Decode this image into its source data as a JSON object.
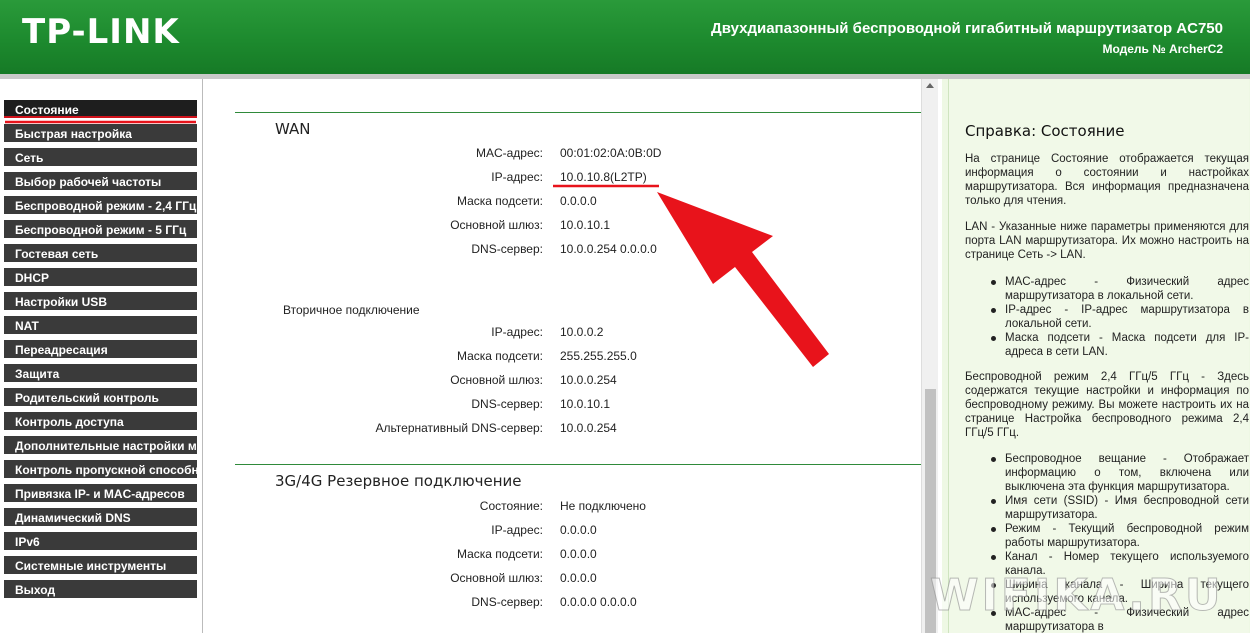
{
  "header": {
    "logo": "TP-LINK",
    "product_title": "Двухдиапазонный беспроводной гигабитный маршрутизатор AC750",
    "model": "Модель № ArcherC2"
  },
  "sidebar": {
    "items": [
      "Состояние",
      "Быстрая настройка",
      "Сеть",
      "Выбор рабочей частоты",
      "Беспроводной режим - 2,4 ГГц",
      "Беспроводной режим - 5 ГГц",
      "Гостевая сеть",
      "DHCP",
      "Настройки USB",
      "NAT",
      "Переадресация",
      "Защита",
      "Родительский контроль",
      "Контроль доступа",
      "Дополнительные настройки м",
      "Контроль пропускной способн",
      "Привязка IP- и MAC-адресов",
      "Динамический DNS",
      "IPv6",
      "Системные инструменты",
      "Выход"
    ],
    "active_index": 0
  },
  "wan": {
    "title": "WAN",
    "rows": [
      {
        "label": "MAC-адрес:",
        "value": "00:01:02:0A:0B:0D"
      },
      {
        "label": "IP-адрес:",
        "value": "10.0.10.8(L2TP)"
      },
      {
        "label": "Маска подсети:",
        "value": "0.0.0.0"
      },
      {
        "label": "Основной шлюз:",
        "value": "10.0.10.1"
      },
      {
        "label": "DNS-сервер:",
        "value": "10.0.0.254 0.0.0.0"
      }
    ],
    "secondary_title": "Вторичное подключение",
    "secondary_rows": [
      {
        "label": "IP-адрес:",
        "value": "10.0.0.2"
      },
      {
        "label": "Маска подсети:",
        "value": "255.255.255.0"
      },
      {
        "label": "Основной шлюз:",
        "value": "10.0.0.254"
      },
      {
        "label": "DNS-сервер:",
        "value": "10.0.10.1"
      },
      {
        "label": "Альтернативный DNS-сервер:",
        "value": "10.0.0.254"
      }
    ]
  },
  "backup": {
    "title": "3G/4G Резервное подключение",
    "rows": [
      {
        "label": "Состояние:",
        "value": "Не подключено"
      },
      {
        "label": "IP-адрес:",
        "value": "0.0.0.0"
      },
      {
        "label": "Маска подсети:",
        "value": "0.0.0.0"
      },
      {
        "label": "Основной шлюз:",
        "value": "0.0.0.0"
      },
      {
        "label": "DNS-сервер:",
        "value": "0.0.0.0 0.0.0.0"
      }
    ]
  },
  "help": {
    "title": "Справка: Состояние",
    "intro": "На странице Состояние отображается текущая информация о состоянии и настройках маршрутизатора. Вся информация предназначена только для чтения.",
    "lan_p": "LAN - Указанные ниже параметры применяются для порта LAN маршрутизатора. Их можно настроить на странице Сеть -> LAN.",
    "lan_items": [
      "MAC-адрес - Физический адрес маршрутизатора в локальной сети.",
      "IP-адрес - IP-адрес маршрутизатора в локальной сети.",
      "Маска подсети - Маска подсети для IP-адреса в сети LAN."
    ],
    "wireless_p": "Беспроводной режим 2,4 ГГц/5 ГГц - Здесь содержатся текущие настройки и информация по беспроводному режиму. Вы можете настроить их на странице Настройка беспроводного режима 2,4 ГГц/5 ГГц.",
    "wireless_items": [
      "Беспроводное вещание - Отображает информацию о том, включена или выключена эта функция маршрутизатора.",
      "Имя сети (SSID) - Имя беспроводной сети маршрутизатора.",
      "Режим - Текущий беспроводной режим работы маршрутизатора.",
      "Канал - Номер текущего используемого канала.",
      "Ширина канала - Ширина текущего используемого канала.",
      "MAC-адрес - Физический адрес маршрутизатора в"
    ]
  },
  "watermark": "WIFIKA.RU",
  "colors": {
    "header_green": "#1d8a2e",
    "annotation_red": "#e8131b",
    "menu_dark": "#3a3a3a"
  }
}
